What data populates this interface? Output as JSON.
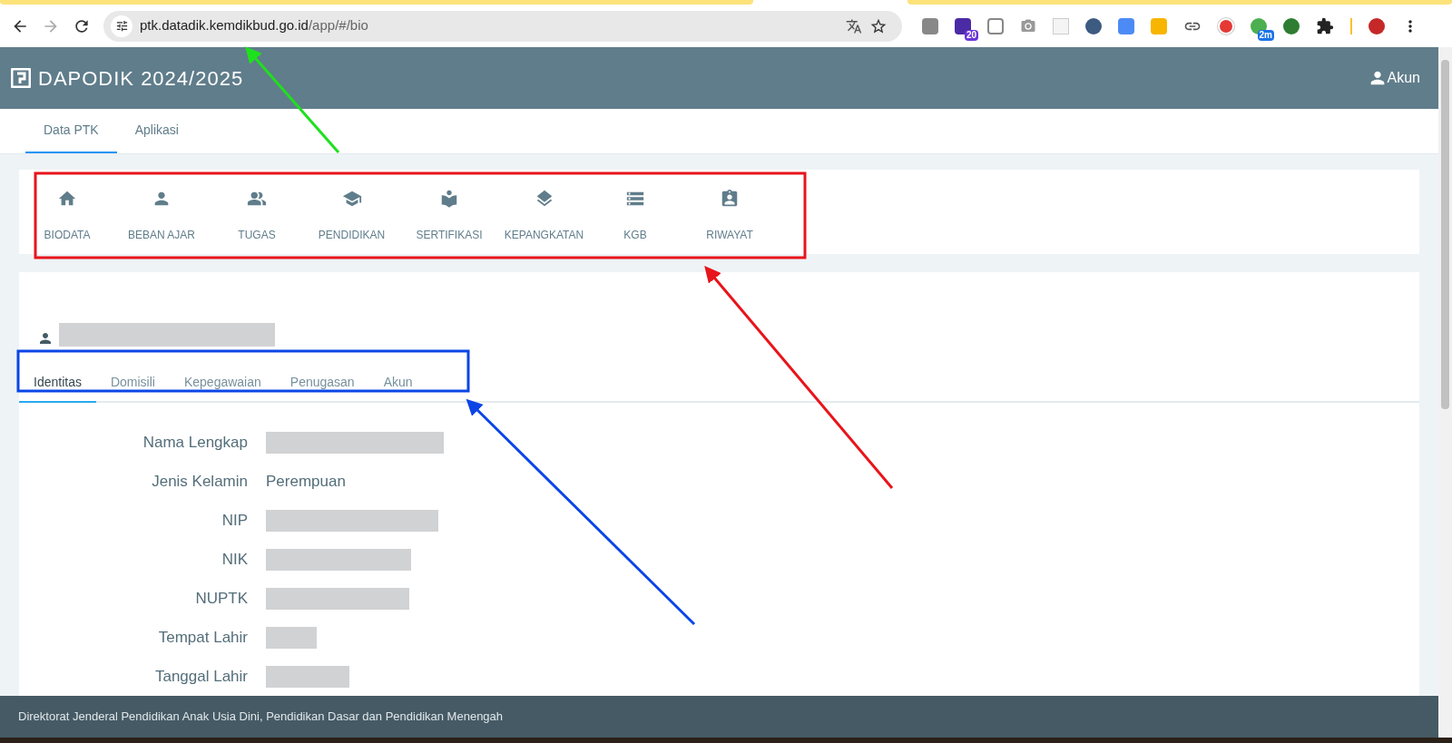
{
  "browser": {
    "url_host": "ptk.datadik.kemdikbud.go.id",
    "url_path": "/app/#/bio",
    "extension_badges": [
      "20",
      "2m"
    ]
  },
  "header": {
    "title": "DAPODIK 2024/2025",
    "account": "Akun"
  },
  "nav_tabs": [
    {
      "label": "Data PTK",
      "selected": true
    },
    {
      "label": "Aplikasi",
      "selected": false
    }
  ],
  "menu": [
    {
      "label": "BIODATA"
    },
    {
      "label": "BEBAN AJAR"
    },
    {
      "label": "TUGAS"
    },
    {
      "label": "PENDIDIKAN"
    },
    {
      "label": "SERTIFIKASI"
    },
    {
      "label": "KEPANGKATAN"
    },
    {
      "label": "KGB"
    },
    {
      "label": "RIWAYAT"
    }
  ],
  "profile": {
    "kind": "redacted"
  },
  "bio_tabs": [
    {
      "label": "Identitas",
      "selected": true
    },
    {
      "label": "Domisili",
      "selected": false
    },
    {
      "label": "Kepegawaian",
      "selected": false
    },
    {
      "label": "Penugasan",
      "selected": false
    },
    {
      "label": "Akun",
      "selected": false
    }
  ],
  "fields": [
    {
      "label": "Nama Lengkap",
      "kind": "redacted"
    },
    {
      "label": "Jenis Kelamin",
      "kind": "text",
      "value": "Perempuan"
    },
    {
      "label": "NIP",
      "kind": "redacted"
    },
    {
      "label": "NIK",
      "kind": "redacted"
    },
    {
      "label": "NUPTK",
      "kind": "redacted"
    },
    {
      "label": "Tempat Lahir",
      "kind": "redacted"
    },
    {
      "label": "Tanggal Lahir",
      "kind": "redacted"
    }
  ],
  "footer": "Direktorat Jenderal Pendidikan Anak Usia Dini, Pendidikan Dasar dan Pendidikan Menengah"
}
